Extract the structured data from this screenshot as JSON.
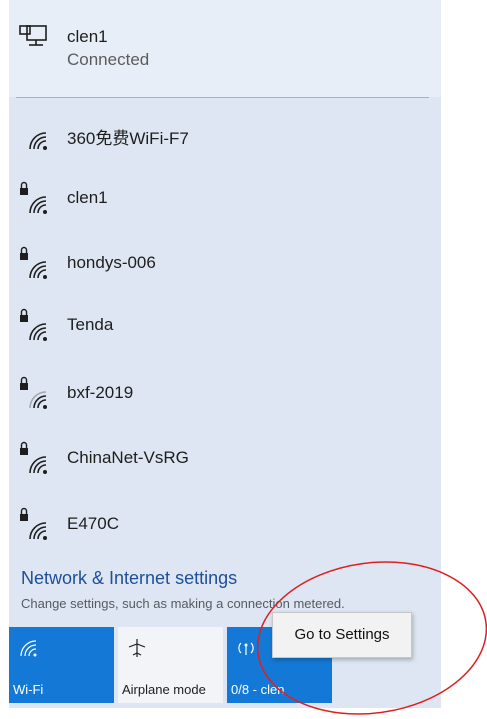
{
  "connected": {
    "name": "clen1",
    "status": "Connected",
    "icon": "ethernet-icon"
  },
  "networks": [
    {
      "name": "360免费WiFi-F7",
      "secured": false,
      "signal": 4
    },
    {
      "name": "clen1",
      "secured": true,
      "signal": 4
    },
    {
      "name": "hondys-006",
      "secured": true,
      "signal": 4
    },
    {
      "name": "Tenda",
      "secured": true,
      "signal": 4
    },
    {
      "name": "bxf-2019",
      "secured": true,
      "signal": 2
    },
    {
      "name": "ChinaNet-VsRG",
      "secured": true,
      "signal": 3
    },
    {
      "name": "E470C",
      "secured": true,
      "signal": 3
    }
  ],
  "settings": {
    "link": "Network & Internet settings",
    "description": "Change settings, such as making a connection metered."
  },
  "tiles": {
    "wifi": {
      "label": "Wi-Fi",
      "icon": "wifi-icon",
      "active": true
    },
    "airplane": {
      "label": "Airplane mode",
      "icon": "airplane-icon",
      "active": false
    },
    "hotspot": {
      "label": "0/8 - clen",
      "icon": "hotspot-icon",
      "active": true
    }
  },
  "tooltip": {
    "text": "Go to Settings"
  },
  "colors": {
    "panel": "#dde6f2",
    "accent": "#1479d6",
    "link": "#1f4e9a",
    "annotation": "#e02020"
  }
}
